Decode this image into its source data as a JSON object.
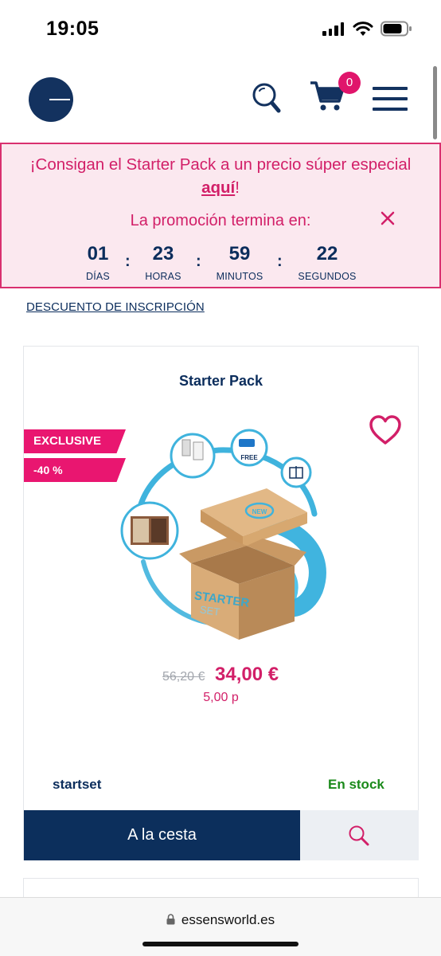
{
  "status_bar": {
    "time": "19:05"
  },
  "header": {
    "cart_count": "0",
    "icons": {
      "logo": "essens-logo",
      "search": "search-icon",
      "cart": "cart-icon",
      "menu": "menu-icon"
    },
    "colors": {
      "navy": "#13325f",
      "pink": "#e0156b"
    }
  },
  "promo": {
    "line1": "¡Consigan el Starter Pack a un precio súper especial",
    "link_text": "aquí",
    "line2_suffix": "!",
    "ends_text": "La promoción termina en:",
    "countdown": {
      "days": "01",
      "days_label": "DÍAS",
      "hours": "23",
      "hours_label": "HORAS",
      "minutes": "59",
      "minutes_label": "MINUTOS",
      "seconds": "22",
      "seconds_label": "SEGUNDOS"
    },
    "separator": ":",
    "background_color": "#fbe8ef",
    "border_color": "#d9306f"
  },
  "discount_link": "DESCUENTO DE INSCRIPCIÓN",
  "product": {
    "title": "Starter Pack",
    "badges": {
      "exclusive": "EXCLUSIVE",
      "discount": "-40 %"
    },
    "image_text": {
      "box_label_1": "STARTER",
      "box_label_2": "SET",
      "lid_label": "NEW",
      "free_label": "FREE"
    },
    "price_old": "56,20 €",
    "price_new": "34,00 €",
    "points": "5,00 p",
    "sku": "startset",
    "stock": "En stock",
    "add_to_cart": "A la cesta",
    "colors": {
      "button": "#0c2f5c",
      "price": "#d21f68",
      "stock": "#1b8a1b"
    }
  },
  "browser": {
    "url": "essensworld.es"
  }
}
